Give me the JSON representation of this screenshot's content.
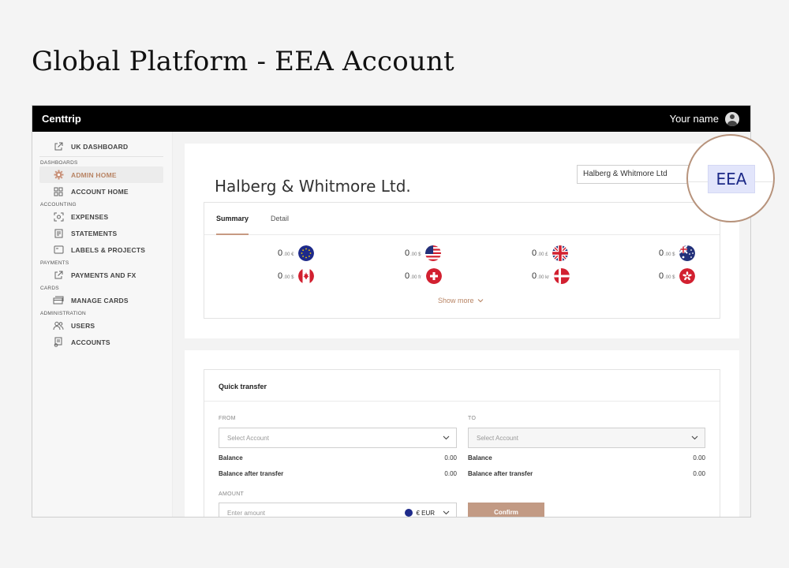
{
  "slide": {
    "title": "Global Platform - EEA Account"
  },
  "topbar": {
    "brand": "Centtrip",
    "user_name": "Your name"
  },
  "sidebar": {
    "uk_dashboard": "UK DASHBOARD",
    "sections": {
      "dashboards": "DASHBOARDS",
      "accounting": "ACCOUNTING",
      "payments": "PAYMENTS",
      "cards": "CARDS",
      "administration": "ADMINISTRATION"
    },
    "items": {
      "admin_home": "ADMIN HOME",
      "account_home": "ACCOUNT HOME",
      "expenses": "EXPENSES",
      "statements": "STATEMENTS",
      "labels_projects": "LABELS & PROJECTS",
      "payments_fx": "PAYMENTS AND FX",
      "manage_cards": "MANAGE CARDS",
      "users": "USERS",
      "accounts": "ACCOUNTS"
    }
  },
  "header": {
    "company_name": "Halberg & Whitmore Ltd.",
    "company_select": "Halberg & Whitmore Ltd",
    "region_badge": "EEA"
  },
  "summary": {
    "tabs": [
      "Summary",
      "Detail"
    ],
    "balances": [
      {
        "whole": "0",
        "decimal": ".00 €",
        "currency": "EUR"
      },
      {
        "whole": "0",
        "decimal": ".00 $",
        "currency": "USD"
      },
      {
        "whole": "0",
        "decimal": ".00 £",
        "currency": "GBP"
      },
      {
        "whole": "0",
        "decimal": ".00 $",
        "currency": "AUD"
      },
      {
        "whole": "0",
        "decimal": ".00 $",
        "currency": "CAD"
      },
      {
        "whole": "0",
        "decimal": ".00 fr",
        "currency": "CHF"
      },
      {
        "whole": "0",
        "decimal": ".00 kr",
        "currency": "DKK"
      },
      {
        "whole": "0",
        "decimal": ".00 $",
        "currency": "HKD"
      }
    ],
    "show_more": "Show more"
  },
  "quick_transfer": {
    "title": "Quick transfer",
    "from_label": "FROM",
    "to_label": "TO",
    "from_placeholder": "Select Account",
    "to_placeholder": "Select Account",
    "balance_label": "Balance",
    "balance_after_label": "Balance after transfer",
    "from_balance": "0.00",
    "from_balance_after": "0.00",
    "to_balance": "0.00",
    "to_balance_after": "0.00",
    "amount_label": "AMOUNT",
    "amount_placeholder": "Enter amount",
    "currency": "€ EUR",
    "confirm": "Confirm"
  },
  "colors": {
    "accent": "#b88464",
    "topbar": "#000000",
    "eea_badge_bg": "#e2e5fb",
    "eea_badge_text": "#1d2a88",
    "confirm_bg": "#c29a84"
  }
}
